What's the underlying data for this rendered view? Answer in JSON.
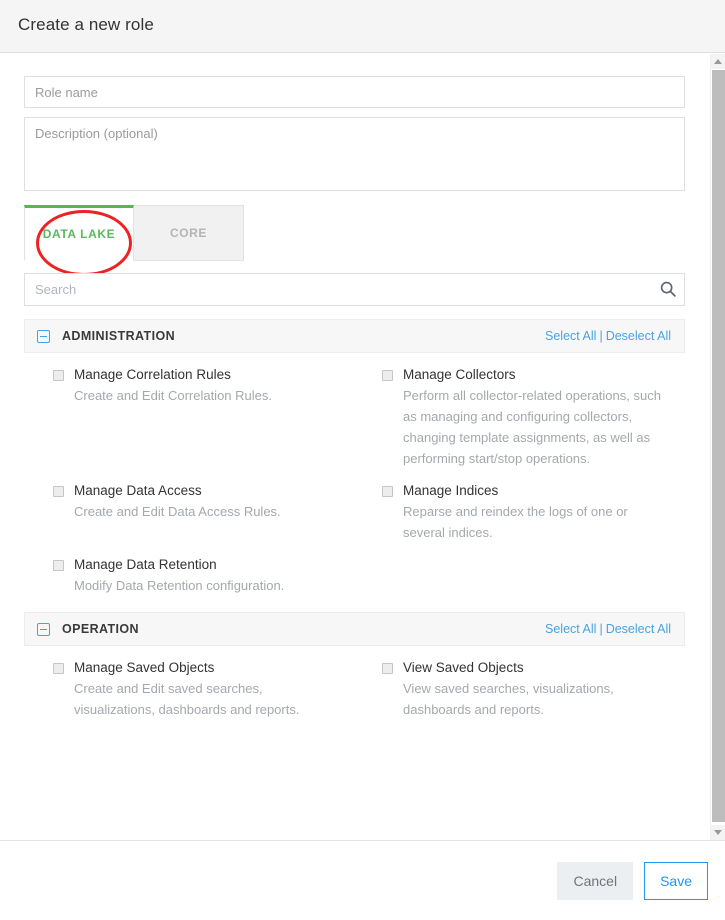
{
  "header": {
    "title": "Create a new role"
  },
  "form": {
    "role_name_placeholder": "Role name",
    "role_name_value": "",
    "description_placeholder": "Description (optional)",
    "description_value": ""
  },
  "tabs": [
    {
      "label": "DATA LAKE",
      "active": true
    },
    {
      "label": "CORE",
      "active": false
    }
  ],
  "search": {
    "placeholder": "Search",
    "value": "",
    "icon": "search-icon"
  },
  "sections": [
    {
      "title": "ADMINISTRATION",
      "collapse_icon": "minus-square-icon",
      "select_all_label": "Select All",
      "separator": "|",
      "deselect_all_label": "Deselect All",
      "permissions": [
        {
          "label": "Manage Correlation Rules",
          "description": "Create and Edit Correlation Rules.",
          "checked": false
        },
        {
          "label": "Manage Collectors",
          "description": "Perform all collector-related operations, such as managing and configuring collectors, changing template assignments, as well as performing start/stop operations.",
          "checked": false
        },
        {
          "label": "Manage Data Access",
          "description": "Create and Edit Data Access Rules.",
          "checked": false
        },
        {
          "label": "Manage Indices",
          "description": "Reparse and reindex the logs of one or several indices.",
          "checked": false
        },
        {
          "label": "Manage Data Retention",
          "description": "Modify Data Retention configuration.",
          "checked": false
        }
      ]
    },
    {
      "title": "OPERATION",
      "collapse_icon": "minus-square-icon",
      "select_all_label": "Select All",
      "separator": "|",
      "deselect_all_label": "Deselect All",
      "permissions": [
        {
          "label": "Manage Saved Objects",
          "description": "Create and Edit saved searches, visualizations, dashboards and reports.",
          "checked": false
        },
        {
          "label": "View Saved Objects",
          "description": "View saved searches, visualizations, dashboards and reports.",
          "checked": false
        }
      ]
    }
  ],
  "footer": {
    "cancel_label": "Cancel",
    "save_label": "Save"
  },
  "scrollbar": {
    "up_icon": "scroll-up-arrow-icon",
    "down_icon": "scroll-down-arrow-icon"
  },
  "annotation": {
    "shape": "red-ellipse-highlight",
    "target": "DATA LAKE"
  },
  "colors": {
    "accent_blue": "#2196f3",
    "link_blue": "#4aa3e0",
    "active_tab_green": "#5cb85c",
    "annotation_red": "#ee2222",
    "muted_text": "#a4a8ad"
  }
}
